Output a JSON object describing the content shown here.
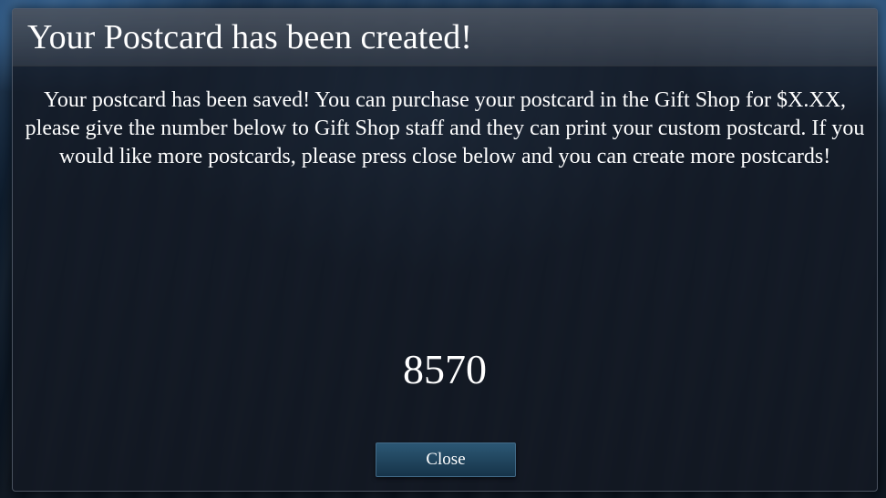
{
  "dialog": {
    "title": "Your Postcard has been created!",
    "message": "Your postcard has been saved! You can purchase your postcard in the Gift Shop for $X.XX, please give the number below to Gift Shop staff and they can print your custom postcard. If you would like more postcards, please press close below and you can create more postcards!",
    "code": "8570",
    "close_label": "Close"
  },
  "colors": {
    "dialog_background": "#141a24",
    "button_top": "#2c5774",
    "button_bottom": "#163449",
    "text": "#ffffff"
  }
}
